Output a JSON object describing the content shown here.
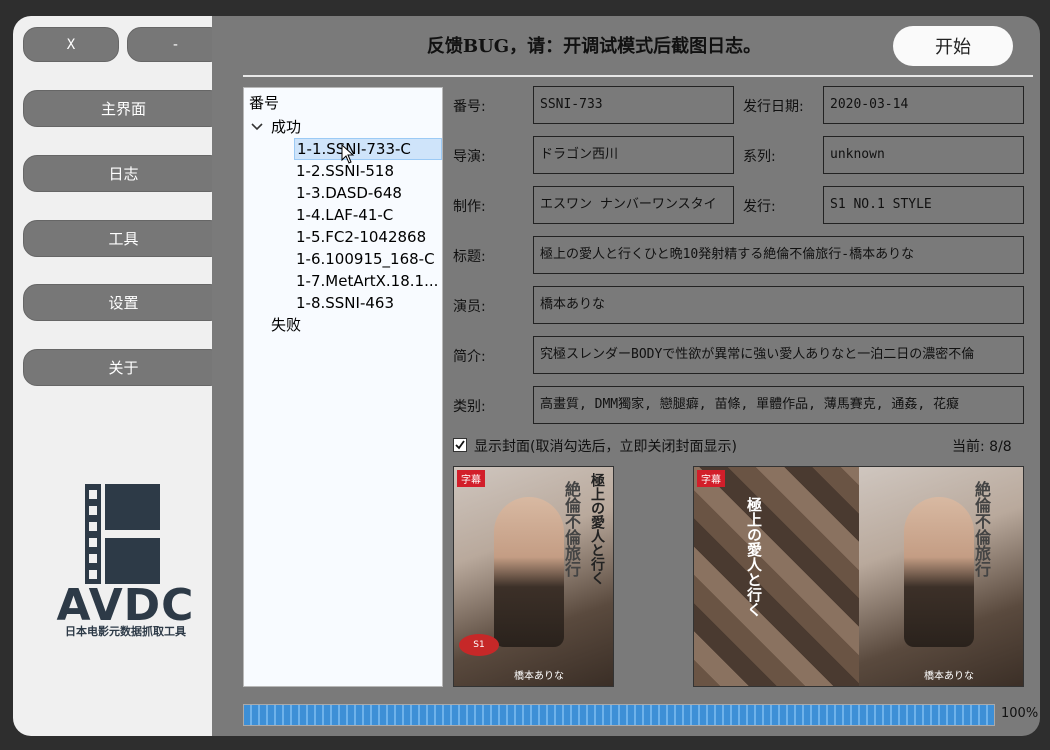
{
  "window": {
    "close_label": "X",
    "minimize_label": "-"
  },
  "nav": [
    {
      "label": "主界面"
    },
    {
      "label": "日志"
    },
    {
      "label": "工具"
    },
    {
      "label": "设置"
    },
    {
      "label": "关于"
    }
  ],
  "logo": {
    "title": "AVDC",
    "subtitle": "日本电影元数据抓取工具"
  },
  "header": {
    "notice": "反馈BUG，请：开调试模式后截图日志。",
    "start_label": "开始"
  },
  "tree": {
    "root": "番号",
    "success_group": "成功",
    "items": [
      "1-1.SSNI-733-C",
      "1-2.SSNI-518",
      "1-3.DASD-648",
      "1-4.LAF-41-C",
      "1-5.FC2-1042868",
      "1-6.100915_168-C",
      "1-7.MetArtX.18.1...",
      "1-8.SSNI-463"
    ],
    "selected_index": 0,
    "failure_group": "失败"
  },
  "fields": {
    "number_label": "番号:",
    "number_value": "SSNI-733",
    "release_label": "发行日期:",
    "release_value": "2020-03-14",
    "director_label": "导演:",
    "director_value": "ドラゴン西川",
    "series_label": "系列:",
    "series_value": "unknown",
    "studio_label": "制作:",
    "studio_value": "エスワン ナンバーワンスタイ",
    "publisher_label": "发行:",
    "publisher_value": "S1 NO.1 STYLE",
    "title_label": "标题:",
    "title_value": "極上の愛人と行くひと晩10発射精する絶倫不倫旅行-橋本ありな",
    "actor_label": "演员:",
    "actor_value": "橋本ありな",
    "outline_label": "简介:",
    "outline_value": "究極スレンダーBODYで性欲が異常に強い愛人ありなと一泊二日の濃密不倫",
    "genre_label": "类别:",
    "genre_value": "高畫質, DMM獨家, 戀腿癖, 苗條, 單體作品, 薄馬賽克, 通姦, 花癡"
  },
  "cover": {
    "show_label": "显示封面(取消勾选后，立即关闭封面显示)",
    "checked": true,
    "current_label": "当前: 8/8",
    "poster_badge": "字幕",
    "poster_text_1": "極上の愛人と行く",
    "poster_text_2": "絶倫不倫旅行",
    "poster_name": "橋本ありな"
  },
  "progress": {
    "value": 100,
    "label": "100%"
  },
  "colors": {
    "main_bg": "#7a7a7a",
    "sidebar_bg": "#f0f0f0",
    "button": "#777777",
    "progress": "#3d8fd6"
  }
}
